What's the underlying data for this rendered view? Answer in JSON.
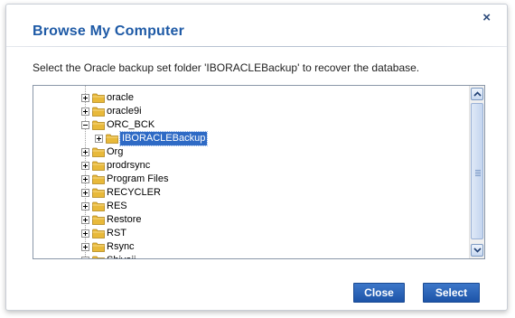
{
  "dialog": {
    "title": "Browse My Computer",
    "close_glyph": "×",
    "instruction": "Select the Oracle backup set folder 'IBORACLEBackup' to recover the database."
  },
  "tree": {
    "items": [
      {
        "label": "oracle",
        "expander": "plus",
        "level": 0
      },
      {
        "label": "oracle9i",
        "expander": "plus",
        "level": 0
      },
      {
        "label": "ORC_BCK",
        "expander": "minus",
        "level": 0
      },
      {
        "label": "IBORACLEBackup",
        "expander": "plus",
        "level": 1,
        "selected": true
      },
      {
        "label": "Org",
        "expander": "plus",
        "level": 0
      },
      {
        "label": "prodrsync",
        "expander": "plus",
        "level": 0
      },
      {
        "label": "Program Files",
        "expander": "plus",
        "level": 0
      },
      {
        "label": "RECYCLER",
        "expander": "plus",
        "level": 0
      },
      {
        "label": "RES",
        "expander": "plus",
        "level": 0
      },
      {
        "label": "Restore",
        "expander": "plus",
        "level": 0
      },
      {
        "label": "RST",
        "expander": "plus",
        "level": 0
      },
      {
        "label": "Rsync",
        "expander": "plus",
        "level": 0
      },
      {
        "label": "Shivaji",
        "expander": "plus",
        "level": 0
      }
    ],
    "scroll_fraction": 0.55
  },
  "buttons": {
    "close_label": "Close",
    "select_label": "Select"
  },
  "colors": {
    "title": "#1e5aa6",
    "button": "#2a62b8",
    "selection": "#2e6ac5",
    "folder": "#e8b93a"
  }
}
